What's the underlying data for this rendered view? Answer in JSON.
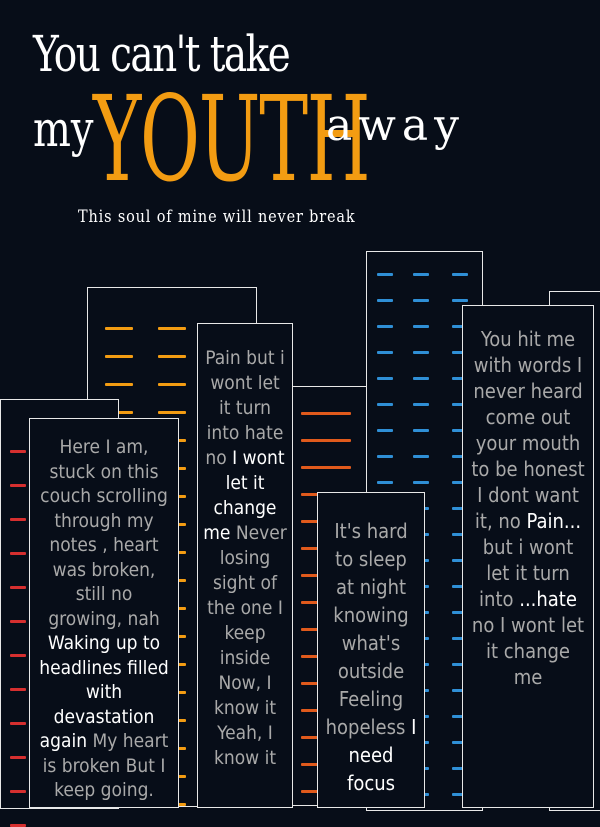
{
  "poster": {
    "line1": "You can't take",
    "line2_pre": "my",
    "line2_big": "YOUTH",
    "line2_post": "away",
    "subtitle": "This soul of mine will never break"
  },
  "colors": {
    "background": "#070d18",
    "orange": "#f39c12",
    "red": "#d62f2f",
    "blue": "#2f8fd6",
    "dark_orange": "#e05a1c",
    "gray_text": "#a9a9a9",
    "white": "#ffffff"
  },
  "lyrics": {
    "left": {
      "gray1": "Here I am, stuck on this couch scrolling through my notes   , heart was broken, still no growing, nah",
      "white": "Waking up to headlines filled with devastation again",
      "gray2": "My heart is broken But I keep going."
    },
    "mid_left": {
      "gray1": "Pain but i wont let it turn into hate no",
      "white": "I wont let it change me",
      "gray2": "Never losing sight of the one I keep inside Now, I know it Yeah, I know it"
    },
    "mid_right": {
      "gray1": "It's hard to sleep at night knowing what's outside Feeling hopeless",
      "white": "I need focus"
    },
    "right": {
      "gray1": "You hit me with words I never heard come out your mouth to be honest I dont want it, no",
      "white1": "Pain...",
      "gray2": "but i wont let it turn into",
      "white2": "...hate",
      "gray3": "no I wont let it change me"
    }
  }
}
